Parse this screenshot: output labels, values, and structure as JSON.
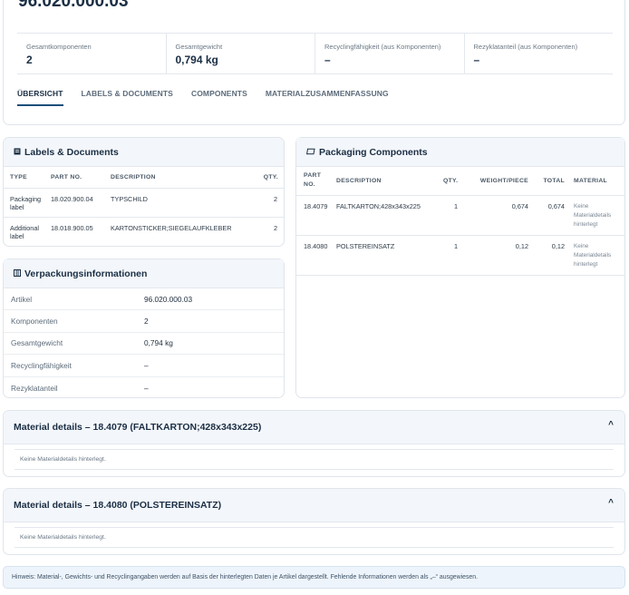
{
  "header": {
    "title": "96.020.000.03",
    "stats": [
      {
        "label": "Gesamtkomponenten",
        "value": "2"
      },
      {
        "label": "Gesamtgewicht",
        "value": "0,794 kg"
      },
      {
        "label": "Recyclingfähigkeit (aus Komponenten)",
        "value": "–"
      },
      {
        "label": "Rezyklatanteil (aus Komponenten)",
        "value": "–"
      }
    ],
    "tabs": [
      "ÜBERSICHT",
      "LABELS & DOCUMENTS",
      "COMPONENTS",
      "MATERIALZUSAMMENFASSUNG"
    ]
  },
  "labels_docs": {
    "title": "Labels & Documents",
    "icon": "document-icon",
    "columns": [
      "TYPE",
      "PART NO.",
      "DESCRIPTION",
      "QTY."
    ],
    "rows": [
      {
        "type_line1": "Packaging",
        "type_line2": "label",
        "part_no": "18.020.900.04",
        "description": "TYPSCHILD",
        "qty": "2"
      },
      {
        "type_line1": "Additional",
        "type_line2": "label",
        "part_no": "18.018.900.05",
        "description": "KARTONSTICKER;SIEGELAUFKLEBER",
        "qty": "2"
      }
    ]
  },
  "verpackung": {
    "title": "Verpackungsinformationen",
    "icon": "columns-icon",
    "rows": [
      {
        "key": "Artikel",
        "value": "96.020.000.03"
      },
      {
        "key": "Komponenten",
        "value": "2"
      },
      {
        "key": "Gesamtgewicht",
        "value": "0,794 kg"
      },
      {
        "key": "Recyclingfähigkeit",
        "value": "–"
      },
      {
        "key": "Rezyklatanteil",
        "value": "–"
      }
    ]
  },
  "packaging": {
    "title": "Packaging Components",
    "icon": "box-icon",
    "columns": {
      "part_l1": "PART",
      "part_l2": "NO.",
      "description": "DESCRIPTION",
      "qty": "QTY.",
      "weight": "WEIGHT/PIECE",
      "total": "TOTAL",
      "material": "MATERIAL"
    },
    "rows": [
      {
        "part_no": "18.4079",
        "description": "FALTKARTON;428x343x225",
        "qty": "1",
        "weight": "0,674",
        "total": "0,674",
        "material_l1": "Keine",
        "material_l2": "Materialdetails",
        "material_l3": "hinterlegt"
      },
      {
        "part_no": "18.4080",
        "description": "POLSTEREINSATZ",
        "qty": "1",
        "weight": "0,12",
        "total": "0,12",
        "material_l1": "Keine",
        "material_l2": "Materialdetails",
        "material_l3": "hinterlegt"
      }
    ]
  },
  "material_details": [
    {
      "title": "Material details – 18.4079 (FALTKARTON;428x343x225)",
      "body": "Keine Materialdetails hinterlegt."
    },
    {
      "title": "Material details – 18.4080 (POLSTEREINSATZ)",
      "body": "Keine Materialdetails hinterlegt."
    }
  ],
  "hint": "Hinweis: Material-, Gewichts- und Recyclingangaben werden auf Basis der hinterlegten Daten je Artikel dargestellt. Fehlende Informationen werden als „–“ ausgewiesen.",
  "colors": {
    "accent": "#1a4f7a",
    "panel_head": "#f3f6fa",
    "hint_bg": "#eef4fb"
  }
}
